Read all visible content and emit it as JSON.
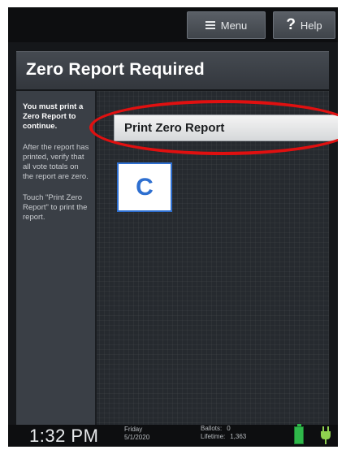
{
  "header": {
    "menu_label": "Menu",
    "help_label": "Help",
    "help_glyph": "?"
  },
  "page": {
    "title": "Zero Report Required"
  },
  "sidebar": {
    "instruction_bold": "You must print a Zero Report to continue.",
    "instruction_verify": "After the report has printed, verify that all vote totals on the report are zero.",
    "instruction_touch": "Touch \"Print Zero Report\" to print the report."
  },
  "main": {
    "print_button_label": "Print Zero Report",
    "callout_label": "C"
  },
  "status": {
    "time": "1:32 PM",
    "day": "Friday",
    "date": "5/1/2020",
    "ballots_label": "Ballots:",
    "ballots_value": "0",
    "lifetime_label": "Lifetime:",
    "lifetime_value": "1,363"
  },
  "colors": {
    "highlight": "#e01010",
    "callout": "#2e6fd0",
    "battery": "#2fb84a",
    "plug": "#8fd14f"
  },
  "icons": {
    "menu": "menu-icon",
    "help": "help-icon",
    "battery": "battery-icon",
    "power": "power-plug-icon"
  }
}
